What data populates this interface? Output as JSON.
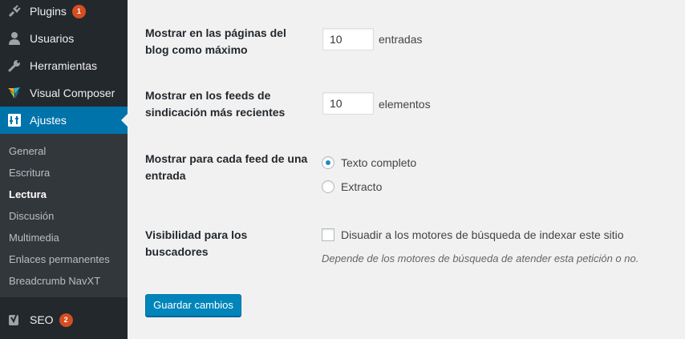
{
  "sidebar": {
    "menu": [
      {
        "label": "Plugins",
        "icon": "plugin-icon",
        "badge": "1"
      },
      {
        "label": "Usuarios",
        "icon": "user-icon"
      },
      {
        "label": "Herramientas",
        "icon": "wrench-icon"
      },
      {
        "label": "Visual Composer",
        "icon": "visual-composer-icon"
      },
      {
        "label": "Ajustes",
        "icon": "settings-icon",
        "current": true
      }
    ],
    "submenu": [
      {
        "label": "General"
      },
      {
        "label": "Escritura"
      },
      {
        "label": "Lectura",
        "active": true
      },
      {
        "label": "Discusión"
      },
      {
        "label": "Multimedia"
      },
      {
        "label": "Enlaces permanentes"
      },
      {
        "label": "Breadcrumb NavXT"
      }
    ],
    "seo": {
      "label": "SEO",
      "icon": "yoast-icon",
      "badge": "2"
    }
  },
  "settings": {
    "blog_pages": {
      "label": "Mostrar en las páginas del blog como máximo",
      "value": "10",
      "unit": "entradas"
    },
    "feed_items": {
      "label": "Mostrar en los feeds de sindicación más recientes",
      "value": "10",
      "unit": "elementos"
    },
    "feed_mode": {
      "label": "Mostrar para cada feed de una entrada",
      "options": [
        "Texto completo",
        "Extracto"
      ],
      "selected": "Texto completo"
    },
    "visibility": {
      "label": "Visibilidad para los buscadores",
      "checkbox_label": "Disuadir a los motores de búsqueda de indexar este sitio",
      "checked": false,
      "description": "Depende de los motores de búsqueda de atender esta petición o no."
    }
  },
  "save_button": "Guardar cambios",
  "colors": {
    "sidebar": "#23282d",
    "submenu": "#32373c",
    "accent": "#0073aa",
    "badge": "#d54e21",
    "button": "#0085ba"
  }
}
